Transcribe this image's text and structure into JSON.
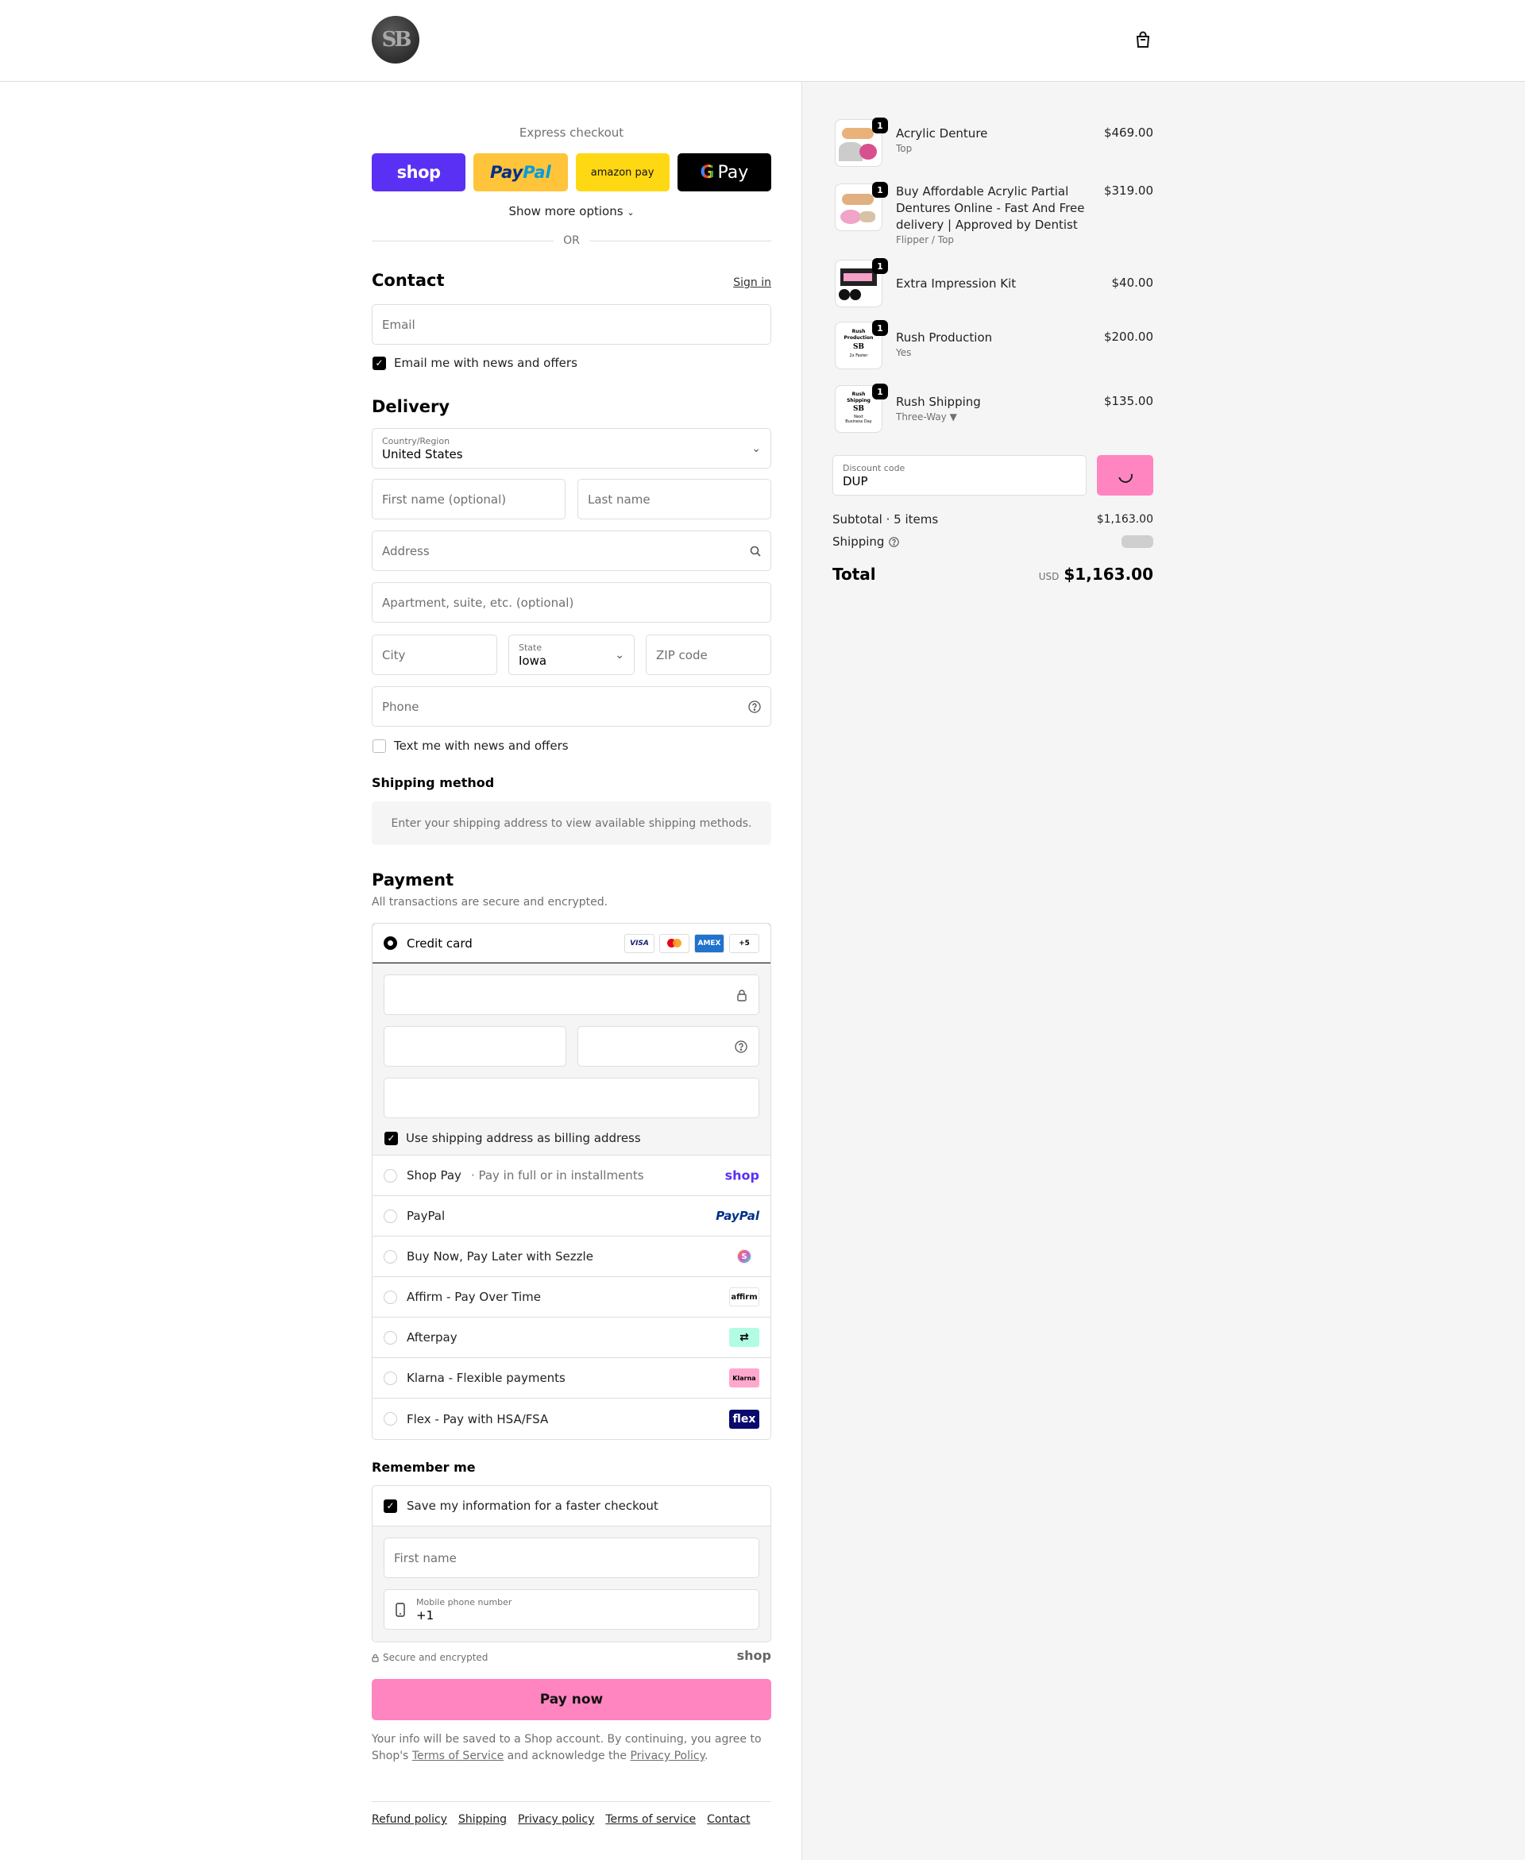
{
  "header": {
    "logo_text": "SB",
    "cart_icon": "shopping-bag-icon"
  },
  "express": {
    "title": "Express checkout",
    "buttons": {
      "shop": "shop",
      "paypal_a": "Pay",
      "paypal_b": "Pal",
      "amazon": "amazon pay",
      "gpay": "Pay",
      "gpay_g": "G"
    },
    "show_more": "Show more options",
    "or": "OR"
  },
  "contact": {
    "title": "Contact",
    "signin": "Sign in",
    "email_placeholder": "Email",
    "news_checkbox": "Email me with news and offers"
  },
  "delivery": {
    "title": "Delivery",
    "country_label": "Country/Region",
    "country_value": "United States",
    "first_name": "First name (optional)",
    "last_name": "Last name",
    "address": "Address",
    "apartment": "Apartment, suite, etc. (optional)",
    "city": "City",
    "state_label": "State",
    "state_value": "Iowa",
    "zip": "ZIP code",
    "phone": "Phone",
    "text_checkbox": "Text me with news and offers"
  },
  "shipping_method": {
    "title": "Shipping method",
    "notice": "Enter your shipping address to view available shipping methods."
  },
  "payment": {
    "title": "Payment",
    "subtitle": "All transactions are secure and encrypted.",
    "credit_card": "Credit card",
    "card_brands": [
      "VISA",
      "MC",
      "AMEX",
      "+5"
    ],
    "billing_checkbox": "Use shipping address as billing address",
    "options": [
      {
        "label": "Shop Pay",
        "sub": "· Pay in full or in installments",
        "brand": "shop"
      },
      {
        "label": "PayPal",
        "sub": "",
        "brand": "PayPal"
      },
      {
        "label": "Buy Now, Pay Later with Sezzle",
        "sub": "",
        "brand": "S"
      },
      {
        "label": "Affirm - Pay Over Time",
        "sub": "",
        "brand": "affirm"
      },
      {
        "label": "Afterpay",
        "sub": "",
        "brand": "⇄"
      },
      {
        "label": "Klarna - Flexible payments",
        "sub": "",
        "brand": "Klarna"
      },
      {
        "label": "Flex - Pay with HSA/FSA",
        "sub": "",
        "brand": "flex"
      }
    ]
  },
  "remember": {
    "title": "Remember me",
    "save_checkbox": "Save my information for a faster checkout",
    "first_name": "First name",
    "mobile_label": "Mobile phone number",
    "mobile_value": "+1",
    "secure": "Secure and encrypted",
    "shop_brand": "shop"
  },
  "pay_now": "Pay now",
  "legal": {
    "text_a": "Your info will be saved to a Shop account. By continuing, you agree to Shop's ",
    "tos": "Terms of Service",
    "text_b": " and acknowledge the ",
    "privacy": "Privacy Policy",
    "text_c": "."
  },
  "footer": [
    "Refund policy",
    "Shipping",
    "Privacy policy",
    "Terms of service",
    "Contact"
  ],
  "summary": {
    "items": [
      {
        "name": "Acrylic Denture",
        "variant": "Top",
        "price": "$469.00",
        "qty": "1"
      },
      {
        "name": "Buy Affordable Acrylic Partial Dentures Online - Fast And Free delivery | Approved by Dentist",
        "variant": "Flipper / Top",
        "price": "$319.00",
        "qty": "1"
      },
      {
        "name": "Extra Impression Kit",
        "variant": "",
        "price": "$40.00",
        "qty": "1"
      },
      {
        "name": "Rush Production",
        "variant": "Yes",
        "price": "$200.00",
        "qty": "1"
      },
      {
        "name": "Rush Shipping",
        "variant": "Three-Way ▼",
        "price": "$135.00",
        "qty": "1"
      }
    ],
    "thumb_texts": {
      "rush_prod": [
        "Rush",
        "Production",
        "SB",
        "2x Faster"
      ],
      "rush_ship": [
        "Rush",
        "Shipping",
        "SB",
        "Next",
        "Business Day"
      ]
    },
    "discount_label": "Discount code",
    "discount_value": "DUP",
    "subtotal_label": "Subtotal · 5 items",
    "subtotal_value": "$1,163.00",
    "shipping_label": "Shipping",
    "total_label": "Total",
    "currency": "USD",
    "total_value": "$1,163.00"
  },
  "colors": {
    "accent_pink": "#ff85c0",
    "shop_purple": "#5a31f4",
    "paypal_yellow": "#ffc439",
    "amazon_yellow": "#ffd814"
  }
}
